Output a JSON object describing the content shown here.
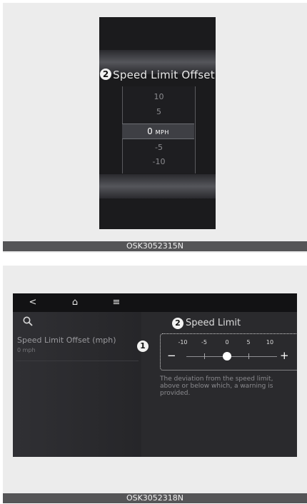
{
  "panel1": {
    "badge": "2",
    "title": "Speed Limit Offset",
    "picker": {
      "options_above": [
        "10",
        "5"
      ],
      "selected_value": "0",
      "selected_unit": "MPH",
      "options_below": [
        "-5",
        "-10"
      ]
    },
    "caption": "OSK3052315N"
  },
  "panel2": {
    "topbar": {
      "back": "<",
      "home": "⌂",
      "menu": "≡"
    },
    "icons": {
      "search": "search-icon",
      "back": "back-arrow-icon",
      "home": "home-icon",
      "menu": "menu-icon"
    },
    "left": {
      "item_label": "Speed Limit Offset (mph)",
      "item_value": "0 mph",
      "callout": "1"
    },
    "right": {
      "callout": "2",
      "title": "Speed Limit",
      "scale": [
        "-10",
        "-5",
        "0",
        "5",
        "10"
      ],
      "minus": "−",
      "plus": "+",
      "selected_value": 0,
      "description": "The deviation from the speed limit, above or below which, a warning is provided."
    },
    "caption": "OSK3052318N"
  }
}
